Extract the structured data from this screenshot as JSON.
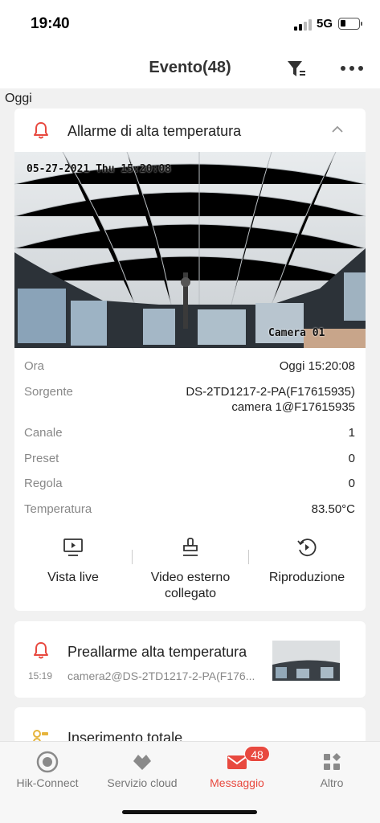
{
  "status_bar": {
    "time": "19:40",
    "network": "5G"
  },
  "nav": {
    "title": "Evento(48)",
    "filter_icon": "filter-icon",
    "more_icon": "more-icon"
  },
  "section": {
    "label": "Oggi"
  },
  "event_main": {
    "icon": "bell-icon",
    "title": "Allarme di alta temperatura",
    "snapshot": {
      "timestamp": "05-27-2021 Thu 15:20:08",
      "camera_label": "Camera 01"
    },
    "details": [
      {
        "key": "Ora",
        "value": "Oggi 15:20:08"
      },
      {
        "key": "Sorgente",
        "value": "DS-2TD1217-2-PA(F17615935)",
        "value2": "camera 1@F17615935"
      },
      {
        "key": "Canale",
        "value": "1"
      },
      {
        "key": "Preset",
        "value": "0"
      },
      {
        "key": "Regola",
        "value": "0"
      },
      {
        "key": "Temperatura",
        "value": "83.50°C"
      }
    ],
    "actions": [
      {
        "label": "Vista live",
        "icon": "monitor-play-icon"
      },
      {
        "label": "Video esterno\ncollegato",
        "icon": "stamp-icon"
      },
      {
        "label": "Riproduzione",
        "icon": "playback-icon"
      }
    ]
  },
  "event_second": {
    "icon": "bell-icon",
    "time": "15:19",
    "title": "Preallarme alta temperatura",
    "subtitle": "camera2@DS-2TD1217-2-PA(F176..."
  },
  "event_third": {
    "icon": "arming-icon",
    "title": "Inserimento totale"
  },
  "tabbar": {
    "tabs": [
      {
        "label": "Hik-Connect",
        "icon": "hik-connect-icon"
      },
      {
        "label": "Servizio cloud",
        "icon": "cloud-service-icon"
      },
      {
        "label": "Messaggio",
        "icon": "message-icon",
        "badge": "48"
      },
      {
        "label": "Altro",
        "icon": "grid-icon"
      }
    ]
  },
  "colors": {
    "accent": "#e8493f",
    "background": "#f1f1f1",
    "card": "#ffffff"
  }
}
